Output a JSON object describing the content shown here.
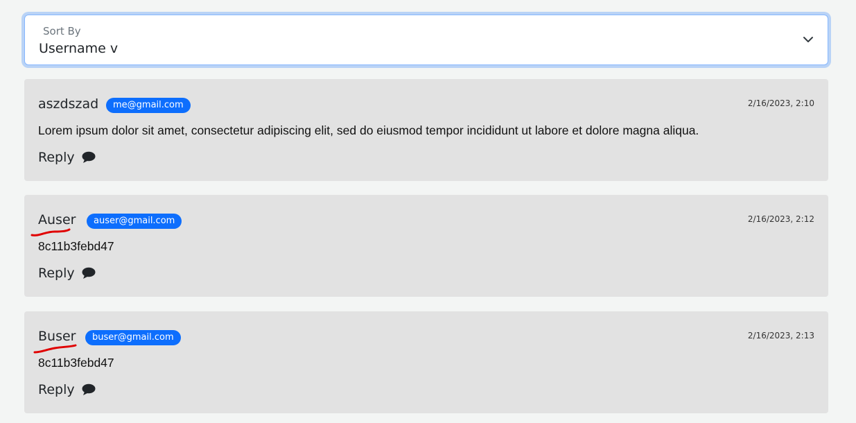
{
  "sort": {
    "label": "Sort By",
    "value": "Username v"
  },
  "comments": [
    {
      "username": "aszdszad",
      "email": "me@gmail.com",
      "timestamp": "2/16/2023, 2:10",
      "text": "Lorem ipsum dolor sit amet, consectetur adipiscing elit, sed do eiusmod tempor incididunt ut labore et dolore magna aliqua.",
      "reply_label": "Reply"
    },
    {
      "username": "Auser",
      "email": "auser@gmail.com",
      "timestamp": "2/16/2023, 2:12",
      "text": "8c11b3febd47",
      "reply_label": "Reply"
    },
    {
      "username": "Buser",
      "email": "buser@gmail.com",
      "timestamp": "2/16/2023, 2:13",
      "text": "8c11b3febd47",
      "reply_label": "Reply"
    }
  ],
  "colors": {
    "badge": "#0d6efd",
    "card_bg": "#e2e2e2",
    "annotation": "#e00000"
  },
  "icons": {
    "sort_chevron": "chevron-down-icon",
    "reply": "speech-bubble-icon"
  }
}
